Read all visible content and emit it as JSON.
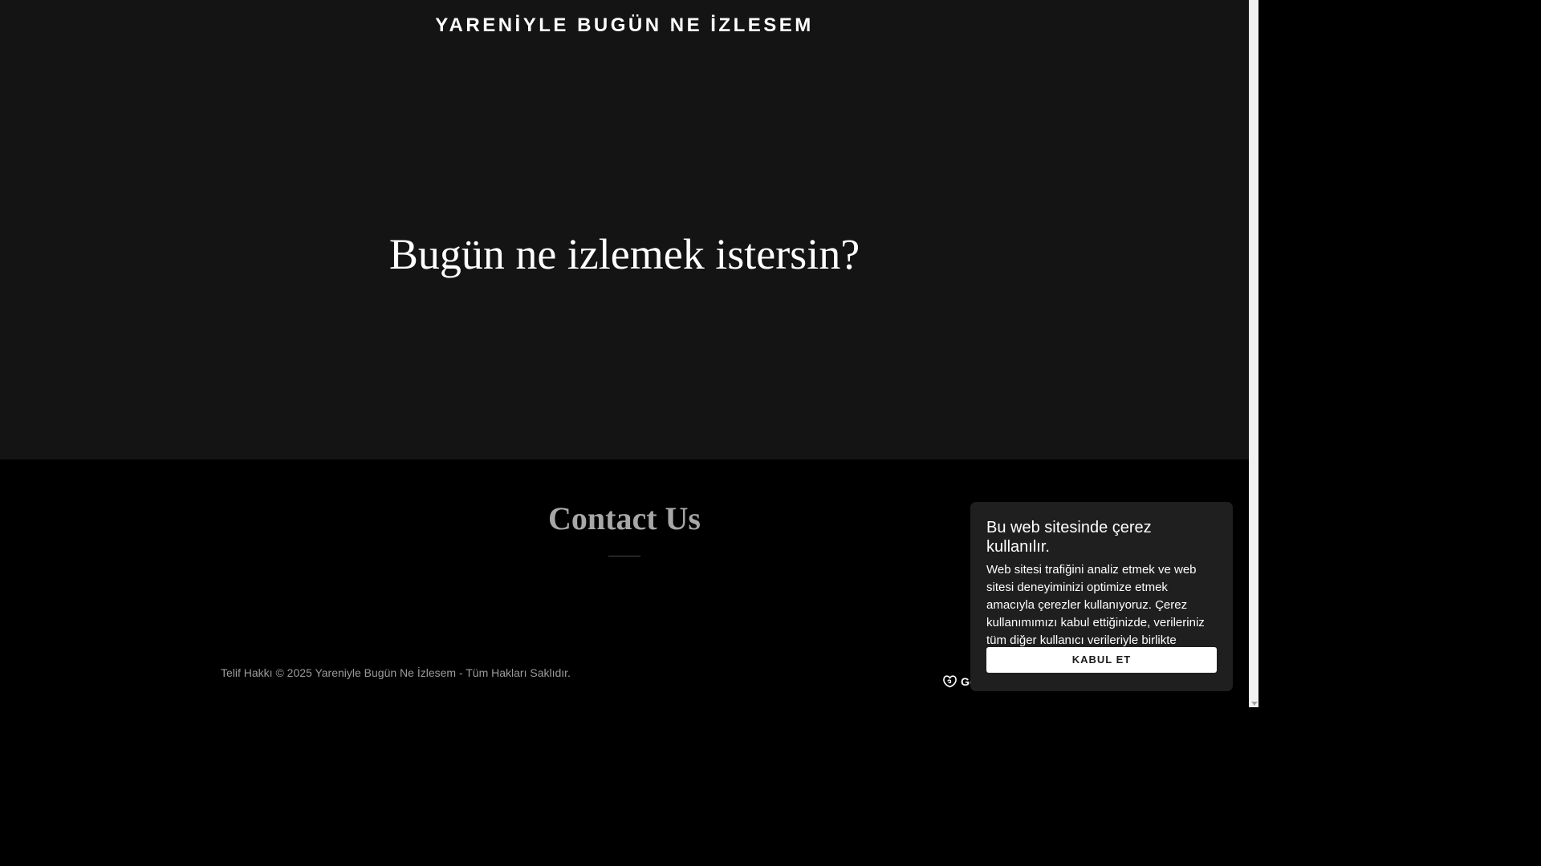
{
  "header": {
    "site_title": "YARENİYLE BUGÜN NE İZLESEM"
  },
  "hero": {
    "headline": "Bugün ne izlemek istersin?"
  },
  "contact": {
    "heading": "Contact Us"
  },
  "footer": {
    "copyright": "Telif Hakkı © 2025 Yareniyle Bugün Ne İzlesem - Tüm Hakları Saklıdır.",
    "powered_by_visible": "Go",
    "powered_icon": "godaddy-logo-icon"
  },
  "cookie_banner": {
    "title": "Bu web sitesinde çerez kullanılır.",
    "body": "Web sitesi trafiğini analiz etmek ve web sitesi deneyiminizi optimize etmek amacıyla çerezler kullanıyoruz. Çerez kullanımımızı kabul ettiğinizde, verileriniz tüm diğer kullanıcı verileriyle birlikte derlenir.",
    "accept_label": "KABUL ET"
  },
  "colors": {
    "hero_background": "#141414",
    "page_background": "#000000",
    "banner_background": "#1f1f1f",
    "contact_heading": "#a7a7a7"
  }
}
